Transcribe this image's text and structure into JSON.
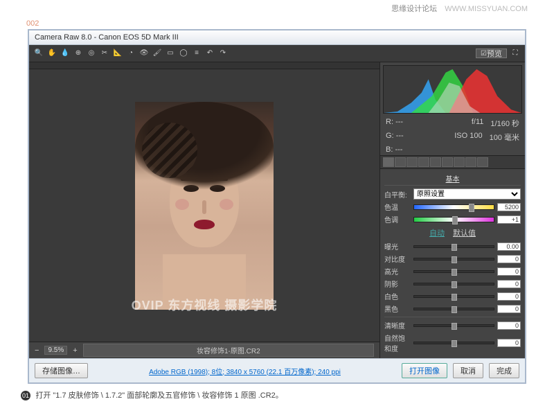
{
  "watermark": {
    "cn": "思缘设计论坛",
    "en": "WWW.MISSYUAN.COM"
  },
  "step": "002",
  "window": {
    "title": "Camera Raw 8.0 - Canon EOS 5D Mark III"
  },
  "toolbar": {
    "preview": "预览"
  },
  "canvas": {
    "overlay": "OVIP 东方视线 摄影学院",
    "zoom": "9.5%",
    "filename": "妆容修饰1-原图.CR2"
  },
  "exif": {
    "r": "R:",
    "g": "G:",
    "b": "B:",
    "rv": "---",
    "gv": "---",
    "bv": "---",
    "aperture": "f/11",
    "shutter": "1/160 秒",
    "iso": "ISO 100",
    "focal": "100 毫米"
  },
  "panel": {
    "title": "基本",
    "wb_label": "白平衡:",
    "wb_value": "原照设置",
    "auto": "自动",
    "default": "默认值",
    "sliders": {
      "temp": {
        "label": "色温",
        "value": "5200"
      },
      "tint": {
        "label": "色调",
        "value": "+1"
      },
      "exposure": {
        "label": "曝光",
        "value": "0.00"
      },
      "contrast": {
        "label": "对比度",
        "value": "0"
      },
      "highlights": {
        "label": "高光",
        "value": "0"
      },
      "shadows": {
        "label": "阴影",
        "value": "0"
      },
      "whites": {
        "label": "白色",
        "value": "0"
      },
      "blacks": {
        "label": "黑色",
        "value": "0"
      },
      "clarity": {
        "label": "清晰度",
        "value": "0"
      },
      "vibrance": {
        "label": "自然饱和度",
        "value": "0"
      }
    }
  },
  "bottom": {
    "save": "存储图像…",
    "meta": "Adobe RGB (1998); 8位; 3840 x 5760 (22.1 百万像素); 240 ppi",
    "open": "打开图像",
    "cancel": "取消",
    "done": "完成"
  },
  "caption": {
    "num": "01",
    "text": "打开 \"1.7 皮肤修饰 \\ 1.7.2\" 面部轮廓及五官修饰 \\ 妆容修饰 1 原图 .CR2。"
  }
}
